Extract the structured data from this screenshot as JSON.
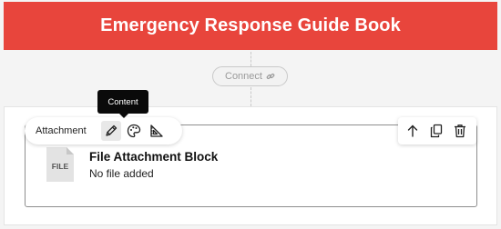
{
  "header": {
    "title": "Emergency Response Guide Book",
    "bg_color": "#e8453c"
  },
  "connect": {
    "label": "Connect",
    "icon": "link-icon"
  },
  "block": {
    "type_label": "Attachment",
    "file_icon_text": "FILE",
    "title": "File Attachment Block",
    "status": "No file added"
  },
  "toolbar": {
    "left_tools": [
      "pencil-icon",
      "palette-icon",
      "set-square-icon"
    ],
    "right_tools": [
      "arrow-up-icon",
      "copy-icon",
      "trash-icon"
    ],
    "tooltip": "Content"
  }
}
